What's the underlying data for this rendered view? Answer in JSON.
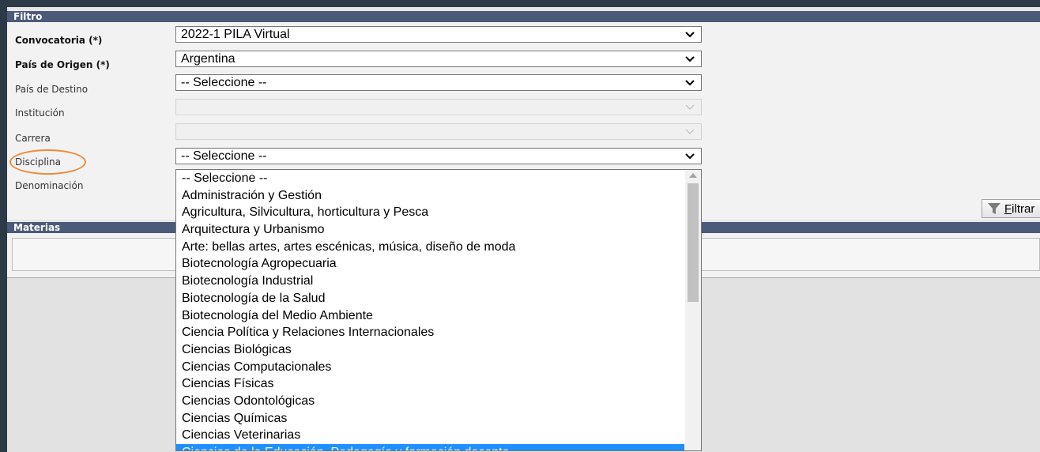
{
  "filtro": {
    "title": "Filtro",
    "fields": {
      "convocatoria": {
        "label": "Convocatoria (*)",
        "value": "2022-1 PILA Virtual"
      },
      "pais_origen": {
        "label": "País de Origen (*)",
        "value": "Argentina"
      },
      "pais_destino": {
        "label": "País de Destino",
        "value": "-- Seleccione --"
      },
      "institucion": {
        "label": "Institución",
        "value": ""
      },
      "carrera": {
        "label": "Carrera",
        "value": ""
      },
      "disciplina": {
        "label": "Disciplina",
        "value": "-- Seleccione --"
      },
      "denominacion": {
        "label": "Denominación",
        "value": ""
      }
    },
    "filtrar_label_first": "F",
    "filtrar_label_rest": "iltrar"
  },
  "materias": {
    "title": "Materias"
  },
  "disciplina_options": [
    "-- Seleccione --",
    "Administración y Gestión",
    "Agricultura, Silvicultura, horticultura y Pesca",
    "Arquitectura y Urbanismo",
    "Arte: bellas artes, artes escénicas, música, diseño de moda",
    "Biotecnología Agropecuaria",
    "Biotecnología Industrial",
    "Biotecnología de la Salud",
    "Biotecnología del Medio Ambiente",
    "Ciencia Política y Relaciones Internacionales",
    "Ciencias Biológicas",
    "Ciencias Computacionales",
    "Ciencias Físicas",
    "Ciencias Odontológicas",
    "Ciencias Químicas",
    "Ciencias Veterinarias",
    "Ciencias de la Educación, Pedagogía y formación docente"
  ],
  "highlighted_option": "Ciencias de la Educación, Pedagogía y formación docente",
  "colors": {
    "header_bg": "#4b5a78",
    "highlight": "#1e90ff",
    "annotation_circle": "#ef8a3b"
  }
}
